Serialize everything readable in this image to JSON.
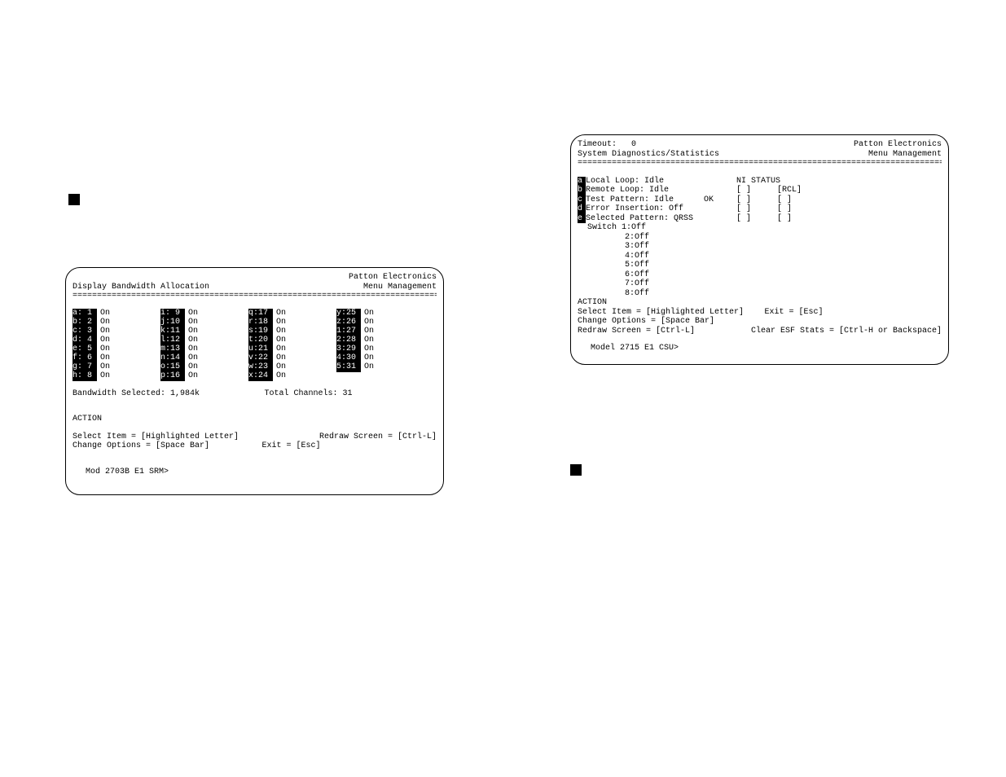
{
  "left": {
    "company": "Patton Electronics",
    "title": "Display Bandwidth Allocation",
    "menu": "Menu Management",
    "rule": "=================================================================================",
    "channels": [
      {
        "k": "a:",
        "n": "1",
        "s": "On"
      },
      {
        "k": "b:",
        "n": "2",
        "s": "On"
      },
      {
        "k": "c:",
        "n": "3",
        "s": "On"
      },
      {
        "k": "d:",
        "n": "4",
        "s": "On"
      },
      {
        "k": "e:",
        "n": "5",
        "s": "On"
      },
      {
        "k": "f:",
        "n": "6",
        "s": "On"
      },
      {
        "k": "g:",
        "n": "7",
        "s": "On"
      },
      {
        "k": "h:",
        "n": "8",
        "s": "On"
      },
      {
        "k": "i:",
        "n": "9",
        "s": "On"
      },
      {
        "k": "j:",
        "n": "10",
        "s": "On"
      },
      {
        "k": "k:",
        "n": "11",
        "s": "On"
      },
      {
        "k": "l:",
        "n": "12",
        "s": "On"
      },
      {
        "k": "m:",
        "n": "13",
        "s": "On"
      },
      {
        "k": "n:",
        "n": "14",
        "s": "On"
      },
      {
        "k": "o:",
        "n": "15",
        "s": "On"
      },
      {
        "k": "p:",
        "n": "16",
        "s": "On"
      },
      {
        "k": "q:",
        "n": "17",
        "s": "On"
      },
      {
        "k": "r:",
        "n": "18",
        "s": "On"
      },
      {
        "k": "s:",
        "n": "19",
        "s": "On"
      },
      {
        "k": "t:",
        "n": "20",
        "s": "On"
      },
      {
        "k": "u:",
        "n": "21",
        "s": "On"
      },
      {
        "k": "v:",
        "n": "22",
        "s": "On"
      },
      {
        "k": "w:",
        "n": "23",
        "s": "On"
      },
      {
        "k": "x:",
        "n": "24",
        "s": "On"
      },
      {
        "k": "y:",
        "n": "25",
        "s": "On"
      },
      {
        "k": "z:",
        "n": "26",
        "s": "On"
      },
      {
        "k": "1:",
        "n": "27",
        "s": "On"
      },
      {
        "k": "2:",
        "n": "28",
        "s": "On"
      },
      {
        "k": "3:",
        "n": "29",
        "s": "On"
      },
      {
        "k": "4:",
        "n": "30",
        "s": "On"
      },
      {
        "k": "5:",
        "n": "31",
        "s": "On"
      }
    ],
    "bw_label": "Bandwidth Selected: 1,984k",
    "tot_label": "Total Channels: 31",
    "action": "ACTION",
    "sel": "Select Item = [Highlighted Letter]",
    "redraw": "Redraw Screen = [Ctrl-L]",
    "change": "Change Options = [Space Bar]",
    "exit": "Exit = [Esc]",
    "prompt": "Mod 2703B E1 SRM>"
  },
  "right": {
    "timeout_label": "Timeout:",
    "timeout_val": "0",
    "company": "Patton Electronics",
    "title": "System Diagnostics/Statistics",
    "menu": "Menu Management",
    "rule": "=================================================================================",
    "ni_status": "NI STATUS",
    "items": [
      {
        "l": "a",
        "label": "Local Loop: Idle",
        "ok": "",
        "b1": "",
        "b2": ""
      },
      {
        "l": "b",
        "label": "Remote Loop: Idle",
        "ok": "",
        "b1": "[   ]",
        "b2": "[RCL]"
      },
      {
        "l": "c",
        "label": "Test Pattern: Idle",
        "ok": "OK",
        "b1": "[   ]",
        "b2": "[   ]"
      },
      {
        "l": "d",
        "label": "Error Insertion: Off",
        "ok": "",
        "b1": "[   ]",
        "b2": "[   ]"
      },
      {
        "l": "e",
        "label": "Selected Pattern: QRSS",
        "ok": "",
        "b1": "[   ]",
        "b2": "[   ]"
      }
    ],
    "switches": [
      "Switch 1:Off",
      "2:Off",
      "3:Off",
      "4:Off",
      "5:Off",
      "6:Off",
      "7:Off",
      "8:Off"
    ],
    "action": "ACTION",
    "sel": "Select Item = [Highlighted Letter]",
    "exit": "Exit = [Esc]",
    "change": "Change Options = [Space Bar]",
    "redraw": "Redraw Screen = [Ctrl-L]",
    "clear": "Clear ESF Stats = [Ctrl-H or Backspace]",
    "prompt": "Model 2715 E1 CSU>"
  }
}
